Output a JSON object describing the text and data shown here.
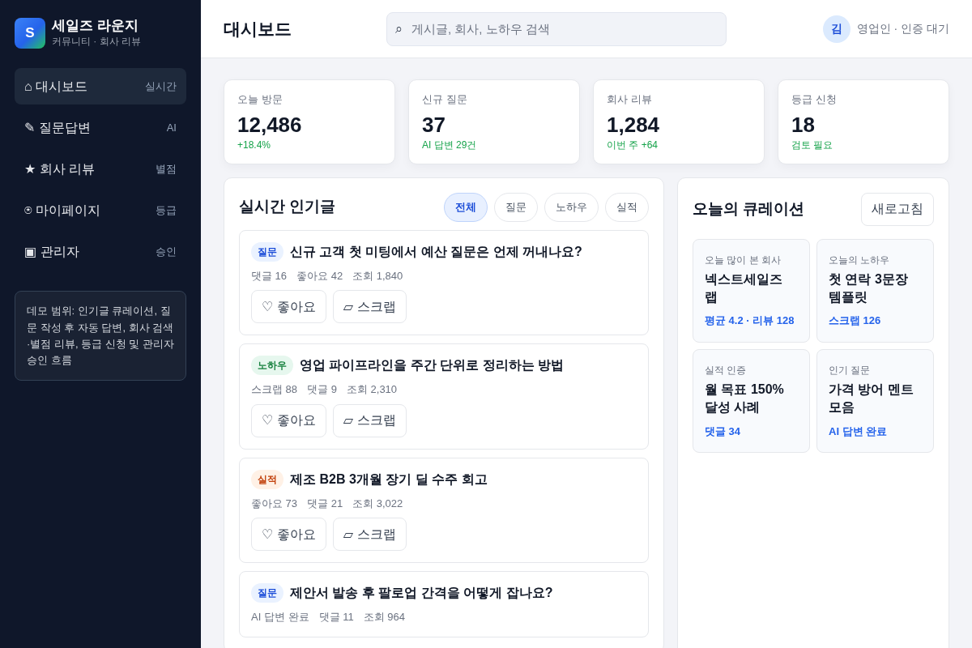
{
  "brand": {
    "logo": "S",
    "name": "세일즈 라운지",
    "tagline": "커뮤니티 · 회사 리뷰"
  },
  "sidebar": {
    "items": [
      {
        "icon": "⌂",
        "label": "대시보드",
        "badge": "실시간",
        "selected": true
      },
      {
        "icon": "✎",
        "label": "질문답변",
        "badge": "AI",
        "selected": false
      },
      {
        "icon": "★",
        "label": "회사 리뷰",
        "badge": "별점",
        "selected": false
      },
      {
        "icon": "⍟",
        "label": "마이페이지",
        "badge": "등급",
        "selected": false
      },
      {
        "icon": "▣",
        "label": "관리자",
        "badge": "승인",
        "selected": false
      }
    ],
    "note": "데모 범위: 인기글 큐레이션, 질문 작성 후 자동 답변, 회사 검색·별점 리뷰, 등급 신청 및 관리자 승인 흐름"
  },
  "header": {
    "title": "대시보드",
    "search": {
      "icon": "⌕",
      "placeholder": "게시글, 회사, 노하우 검색"
    },
    "user": {
      "avatar": "김",
      "status": "영업인 · 인증 대기"
    }
  },
  "stats": [
    {
      "label": "오늘 방문",
      "value": "12,486",
      "delta": "+18.4%"
    },
    {
      "label": "신규 질문",
      "value": "37",
      "delta": "AI 답변 29건"
    },
    {
      "label": "회사 리뷰",
      "value": "1,284",
      "delta": "이번 주 +64"
    },
    {
      "label": "등급 신청",
      "value": "18",
      "delta": "검토 필요"
    }
  ],
  "popular": {
    "title": "실시간 인기글",
    "filters": [
      {
        "label": "전체",
        "selected": true
      },
      {
        "label": "질문",
        "selected": false
      },
      {
        "label": "노하우",
        "selected": false
      },
      {
        "label": "실적",
        "selected": false
      }
    ],
    "posts": [
      {
        "tag": {
          "kind": "question",
          "label": "질문"
        },
        "title": "신규 고객 첫 미팅에서 예산 질문은 언제 꺼내나요?",
        "meta": [
          "댓글 16",
          "좋아요 42",
          "조회 1,840"
        ],
        "actions": [
          {
            "icon": "♡",
            "label": "좋아요"
          },
          {
            "icon": "▱",
            "label": "스크랩"
          }
        ]
      },
      {
        "tag": {
          "kind": "knowhow",
          "label": "노하우"
        },
        "title": "영업 파이프라인을 주간 단위로 정리하는 방법",
        "meta": [
          "스크랩 88",
          "댓글 9",
          "조회 2,310"
        ],
        "actions": [
          {
            "icon": "♡",
            "label": "좋아요"
          },
          {
            "icon": "▱",
            "label": "스크랩"
          }
        ]
      },
      {
        "tag": {
          "kind": "result",
          "label": "실적"
        },
        "title": "제조 B2B 3개월 장기 딜 수주 회고",
        "meta": [
          "좋아요 73",
          "댓글 21",
          "조회 3,022"
        ],
        "actions": [
          {
            "icon": "♡",
            "label": "좋아요"
          },
          {
            "icon": "▱",
            "label": "스크랩"
          }
        ]
      },
      {
        "tag": {
          "kind": "question",
          "label": "질문"
        },
        "title": "제안서 발송 후 팔로업 간격을 어떻게 잡나요?",
        "meta": [
          "AI 답변 완료",
          "댓글 11",
          "조회 964"
        ]
      }
    ]
  },
  "curation": {
    "title": "오늘의 큐레이션",
    "refresh": "새로고침",
    "cards": [
      {
        "label": "오늘 많이 본 회사",
        "title": "넥스트세일즈 랩",
        "meta": "평균 4.2 · 리뷰 128"
      },
      {
        "label": "오늘의 노하우",
        "title": "첫 연락 3문장 템플릿",
        "meta": "스크랩 126"
      },
      {
        "label": "실적 인증",
        "title": "월 목표 150% 달성 사례",
        "meta": "댓글 34"
      },
      {
        "label": "인기 질문",
        "title": "가격 방어 멘트 모음",
        "meta": "AI 답변 완료"
      }
    ]
  }
}
